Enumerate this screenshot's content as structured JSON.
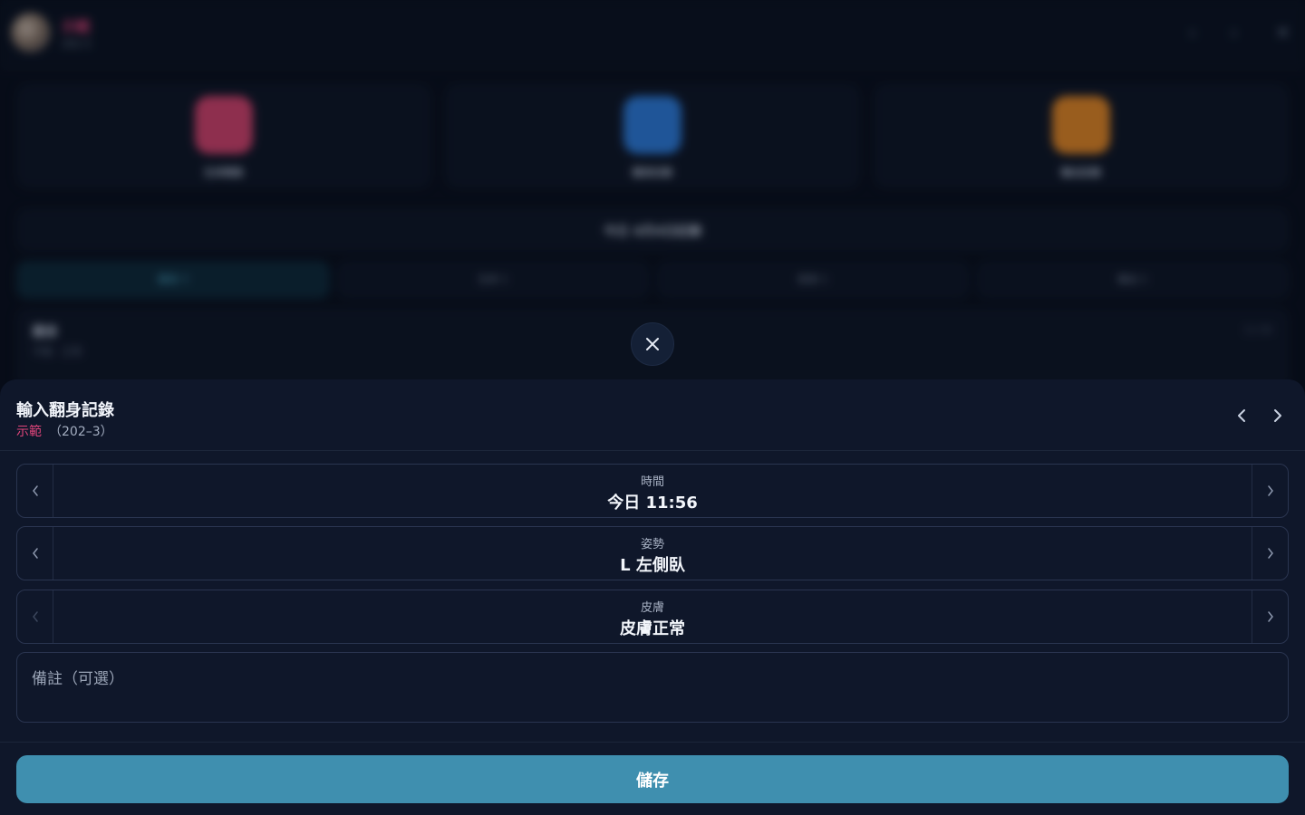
{
  "background": {
    "resident_name": "示範",
    "resident_room": "202-3",
    "quick_actions": [
      {
        "label": "生命徵象",
        "icon": "heart-icon",
        "color": "#d9446f"
      },
      {
        "label": "翻身記錄",
        "icon": "rotate-icon",
        "color": "#2f7fe0"
      },
      {
        "label": "輸出記錄",
        "icon": "output-icon",
        "color": "#ea8a25"
      }
    ],
    "date_label": "今日 4月4日記錄",
    "tabs": [
      "翻身 3",
      "生命 1",
      "飲食 1",
      "輸出 1"
    ],
    "record": {
      "title": "翻身",
      "subtitle": "平躺 · 正常",
      "time": "11:56"
    }
  },
  "sheet": {
    "title": "輸入翻身記錄",
    "resident_name": "示範",
    "resident_room": "（202–3）",
    "fields": [
      {
        "label": "時間",
        "value": "今日 11:56"
      },
      {
        "label": "姿勢",
        "value": "L 左側臥"
      },
      {
        "label": "皮膚",
        "value": "皮膚正常"
      }
    ],
    "note_placeholder": "備註（可選）",
    "save_label": "儲存"
  }
}
